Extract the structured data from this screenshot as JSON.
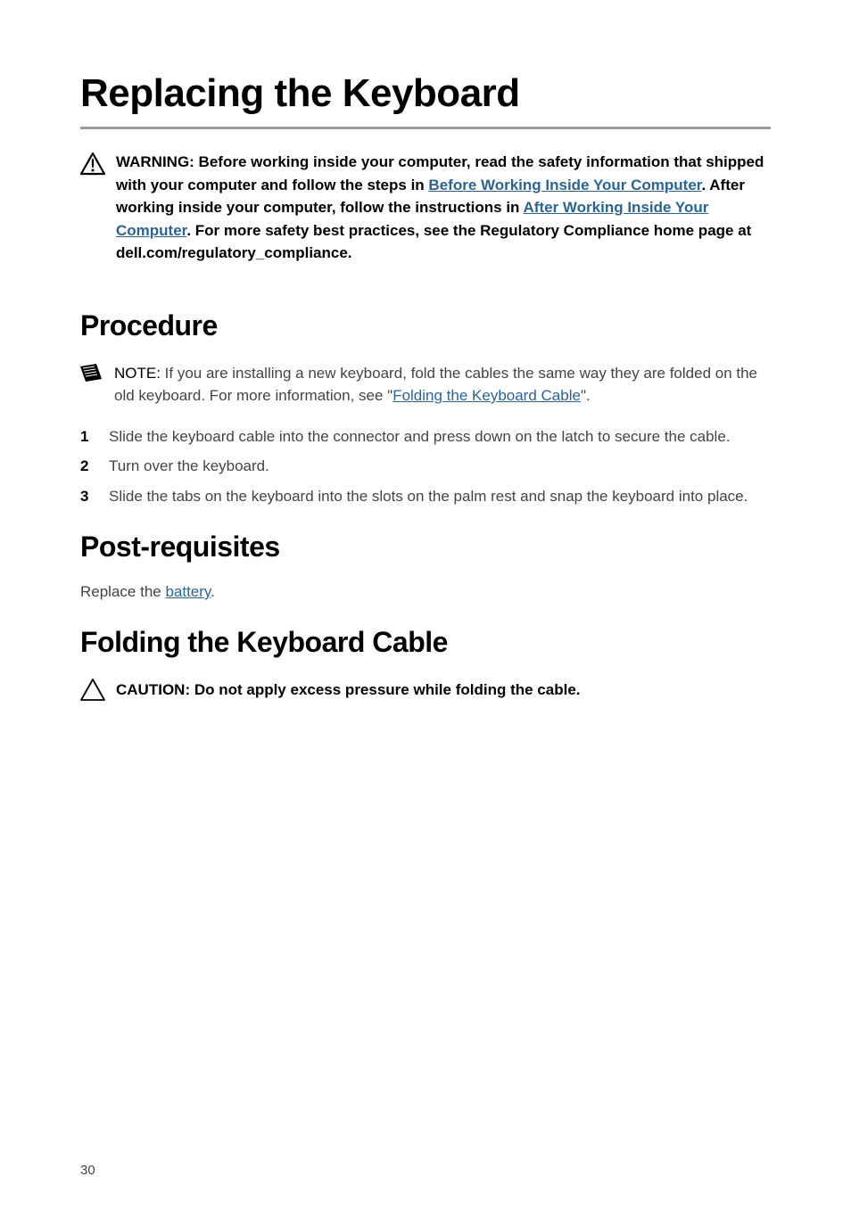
{
  "page_title": "Replacing the Keyboard",
  "warning": {
    "prefix": "WARNING: Before working inside your computer, read the safety information that shipped with your computer and follow the steps in ",
    "link1": "Before Working Inside Your Computer",
    "middle1": ". After working inside your computer, follow the instructions in ",
    "link2": "After Working Inside Your Computer",
    "suffix": ". For more safety best practices, see the Regulatory Compliance home page at dell.com/regulatory_compliance."
  },
  "procedure": {
    "heading": "Procedure",
    "note_label": "NOTE: ",
    "note_text1": "If you are installing a new keyboard, fold the cables the same way they are folded on the old keyboard. For more information, see \"",
    "note_link": "Folding the Keyboard Cable",
    "note_text2": "\".",
    "steps": [
      "Slide the keyboard cable into the connector and press down on the latch to secure the cable.",
      "Turn over the keyboard.",
      "Slide the tabs on the keyboard into the slots on the palm rest and snap the keyboard into place."
    ]
  },
  "postreq": {
    "heading": "Post-requisites",
    "text_prefix": "Replace the ",
    "link": "battery",
    "text_suffix": "."
  },
  "folding": {
    "heading": "Folding the Keyboard Cable",
    "caution": "CAUTION: Do not apply excess pressure while folding the cable."
  },
  "page_number": "30"
}
